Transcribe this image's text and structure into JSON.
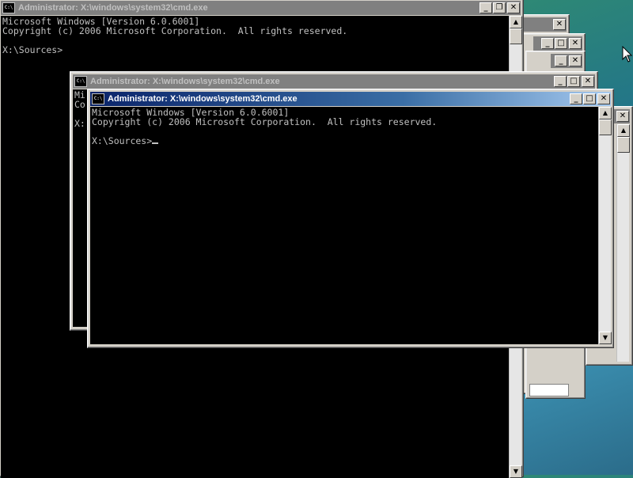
{
  "windows": {
    "back": {
      "title": "Administrator: X:\\windows\\system32\\cmd.exe",
      "lines": [
        "Microsoft Windows [Version 6.0.6001]",
        "Copyright (c) 2006 Microsoft Corporation.  All rights reserved.",
        "",
        "X:\\Sources>"
      ]
    },
    "middle": {
      "title": "Administrator: X:\\windows\\system32\\cmd.exe",
      "partial_lines": [
        "Mi",
        "Co",
        "",
        "X:"
      ]
    },
    "front": {
      "title": "Administrator: X:\\windows\\system32\\cmd.exe",
      "lines": [
        "Microsoft Windows [Version 6.0.6001]",
        "Copyright (c) 2006 Microsoft Corporation.  All rights reserved.",
        "",
        "X:\\Sources>"
      ]
    }
  },
  "icons": {
    "console": "cmd-icon",
    "minimize": "minimize-icon",
    "maximize": "maximize-icon",
    "restore": "restore-icon",
    "close": "close-icon",
    "scroll_up": "arrow-up-icon",
    "scroll_down": "arrow-down-icon",
    "mouse": "mouse-pointer-icon"
  },
  "glyphs": {
    "close": "✕",
    "up": "▲",
    "down": "▼",
    "icon_text": "C:\\"
  },
  "colors": {
    "active_title_start": "#0a246a",
    "active_title_end": "#a6caf0",
    "inactive_title": "#808080",
    "console_bg": "#000000",
    "console_fg": "#c0c0c0"
  }
}
